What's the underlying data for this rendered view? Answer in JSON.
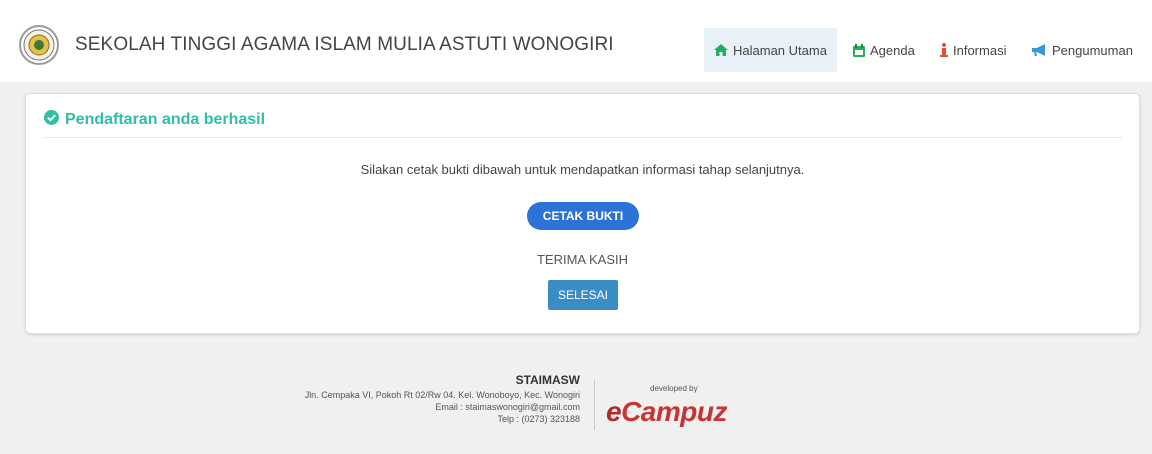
{
  "header": {
    "title": "SEKOLAH TINGGI AGAMA ISLAM MULIA ASTUTI WONOGIRI",
    "logo_icon": "institution-seal-icon",
    "nav": [
      {
        "label": "Halaman Utama",
        "icon": "home-icon",
        "color": "#27ae60",
        "active": true
      },
      {
        "label": "Agenda",
        "icon": "calendar-icon",
        "color": "#27ae60",
        "active": false
      },
      {
        "label": "Informasi",
        "icon": "info-icon",
        "color": "#e74c3c",
        "active": false
      },
      {
        "label": "Pengumuman",
        "icon": "megaphone-icon",
        "color": "#3498db",
        "active": false
      }
    ]
  },
  "card": {
    "header_title": "Pendaftaran anda berhasil",
    "header_icon": "check-circle-icon",
    "message": "Silakan cetak bukti dibawah untuk mendapatkan informasi tahap selanjutnya.",
    "print_button": "CETAK BUKTI",
    "thanks": "TERIMA KASIH",
    "finish_button": "SELESAI"
  },
  "footer": {
    "name": "STAIMASW",
    "address": "Jln. Cempaka VI, Pokoh Rt 02/Rw 04. Kel. Wonoboyo, Kec. Wonogiri",
    "email": "Email : staimaswonogiri@gmail.com",
    "phone": "Telp : (0273) 323188",
    "developed_by": "developed by",
    "brand_e": "e",
    "brand_rest": "Campuz"
  },
  "colors": {
    "accent_green": "#2ebfa5",
    "primary_blue": "#2d73d7",
    "secondary_blue": "#3a8dc4",
    "brand_red": "#c83434"
  }
}
